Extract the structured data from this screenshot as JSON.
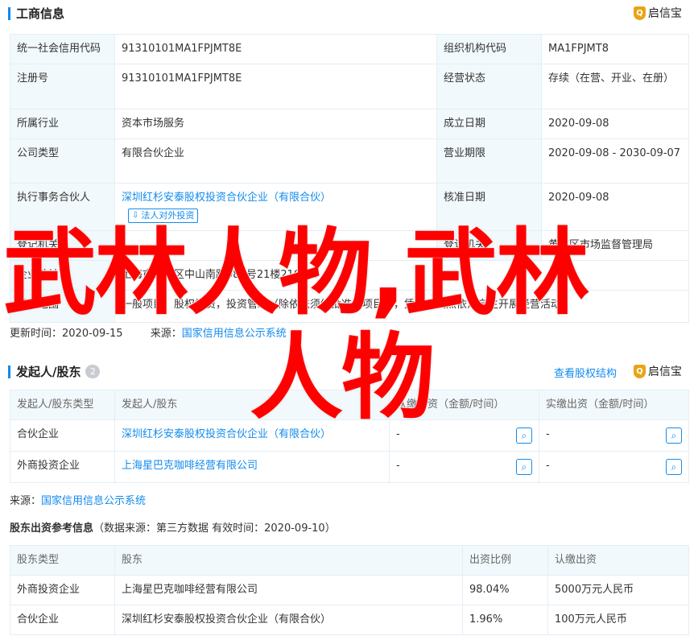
{
  "business_info": {
    "title": "工商信息",
    "brand": "启信宝",
    "rows": [
      {
        "label1": "统一社会信用代码",
        "value1": "91310101MA1FPJMT8E",
        "label2": "组织机构代码",
        "value2": "MA1FPJMT8"
      },
      {
        "label1": "注册号",
        "value1": "91310101MA1FPJMT8E",
        "label2": "经营状态",
        "value2": "存续（在营、开业、在册）"
      },
      {
        "label1": "所属行业",
        "value1": "资本市场服务",
        "label2": "成立日期",
        "value2": "2020-09-08"
      },
      {
        "label1": "公司类型",
        "value1": "有限合伙企业",
        "label2": "营业期限",
        "value2": "2020-09-08 - 2030-09-07"
      },
      {
        "label1": "执行事务合伙人",
        "value1": "深圳红杉安泰股权投资合伙企业（有限合伙）",
        "tag": "法人对外投资",
        "label2": "核准日期",
        "value2": "2020-09-08"
      },
      {
        "label1": "登记机关",
        "value1": "-",
        "label2": "登记机关",
        "value2": "黄浦区市场监督管理局"
      },
      {
        "label1": "企业地址",
        "value1": "上海市黄浦区中山南路989号21楼2105-2",
        "label2": "",
        "value2": ""
      },
      {
        "label1": "经营范围",
        "value1": "一般项目：股权投资，投资管理（除依法须经批准的项目外，凭营业执照依法自主开展经营活动）",
        "label2": "",
        "value2": ""
      }
    ],
    "updated_label": "更新时间：",
    "updated_value": "2020-09-15",
    "source_label": "来源：",
    "source_value": "国家信用信息公示系统"
  },
  "shareholders": {
    "title": "发起人/股东",
    "count": "2",
    "link": "查看股权结构",
    "brand": "启信宝",
    "headers": [
      "发起人/股东类型",
      "发起人/股东",
      "认缴出资（金额/时间）",
      "实缴出资（金额/时间）"
    ],
    "rows": [
      {
        "type": "合伙企业",
        "name": "深圳红杉安泰股权投资合伙企业（有限合伙）",
        "subscribed": "-",
        "paid": "-"
      },
      {
        "type": "外商投资企业",
        "name": "上海星巴克咖啡经营有限公司",
        "subscribed": "-",
        "paid": "-"
      }
    ],
    "source_label": "来源：",
    "source_value": "国家信用信息公示系统"
  },
  "contribution": {
    "title": "股东出资参考信息",
    "note": "（数据来源：第三方数据 有效时间：2020-09-10）",
    "headers": [
      "股东类型",
      "股东",
      "出资比例",
      "认缴出资"
    ],
    "rows": [
      {
        "type": "外商投资企业",
        "name": "上海星巴克咖啡经营有限公司",
        "ratio": "98.04%",
        "amount": "5000万元人民币"
      },
      {
        "type": "合伙企业",
        "name": "深圳红杉安泰股权投资合伙企业（有限合伙）",
        "ratio": "1.96%",
        "amount": "100万元人民币"
      }
    ]
  },
  "overlay": {
    "line1": "武林人物,武林",
    "line2": "人物"
  },
  "colors": {
    "accent": "#128bed",
    "overlay": "#ff0000",
    "brand": "#e8a417"
  }
}
